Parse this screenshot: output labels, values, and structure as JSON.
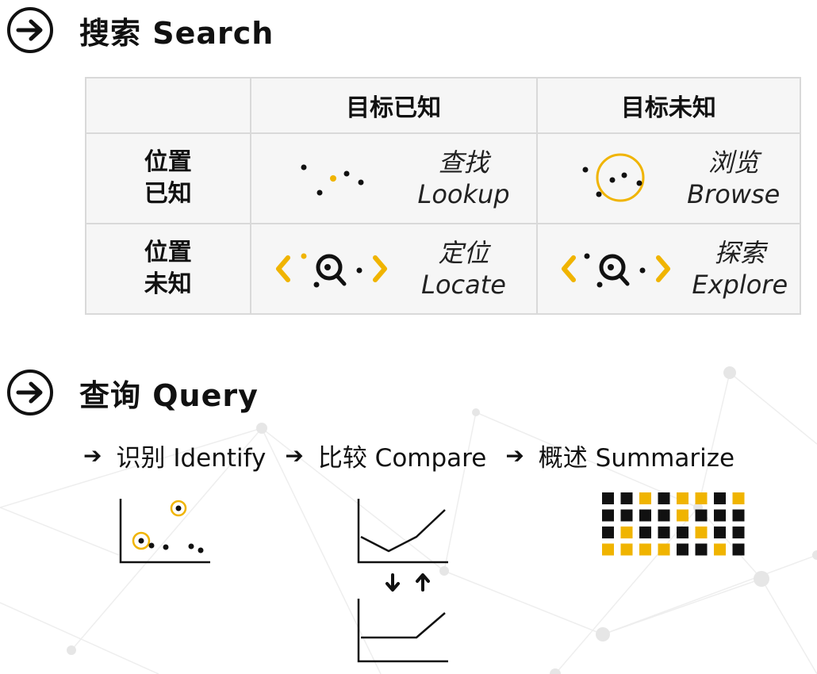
{
  "colors": {
    "accent": "#f0b400",
    "ink": "#111111",
    "grid": "#d9d9d9",
    "table_bg": "#f6f6f6"
  },
  "search": {
    "icon": "circle-arrow-icon",
    "title": "搜索 Search",
    "header": {
      "blank": "",
      "target_known": "目标已知",
      "target_unknown": "目标未知"
    },
    "rows": [
      {
        "label_1": "位置",
        "label_2": "已知",
        "cells": [
          {
            "cn": "查找",
            "en": "Lookup"
          },
          {
            "cn": "浏览",
            "en": "Browse"
          }
        ]
      },
      {
        "label_1": "位置",
        "label_2": "未知",
        "cells": [
          {
            "cn": "定位",
            "en": "Locate"
          },
          {
            "cn": "探索",
            "en": "Explore"
          }
        ]
      }
    ]
  },
  "query": {
    "icon": "circle-arrow-icon",
    "title": "查询 Query",
    "steps": [
      {
        "arrow": "➔",
        "label": "识别 Identify"
      },
      {
        "arrow": "➔",
        "label": "比较 Compare"
      },
      {
        "arrow": "➔",
        "label": "概述 Summarize"
      }
    ],
    "summarize_grid": [
      [
        0,
        0,
        1,
        0,
        1,
        1,
        0,
        1
      ],
      [
        0,
        0,
        0,
        0,
        1,
        0,
        0,
        0
      ],
      [
        0,
        1,
        0,
        0,
        0,
        1,
        0,
        0
      ],
      [
        1,
        1,
        1,
        1,
        0,
        0,
        1,
        0
      ]
    ]
  }
}
